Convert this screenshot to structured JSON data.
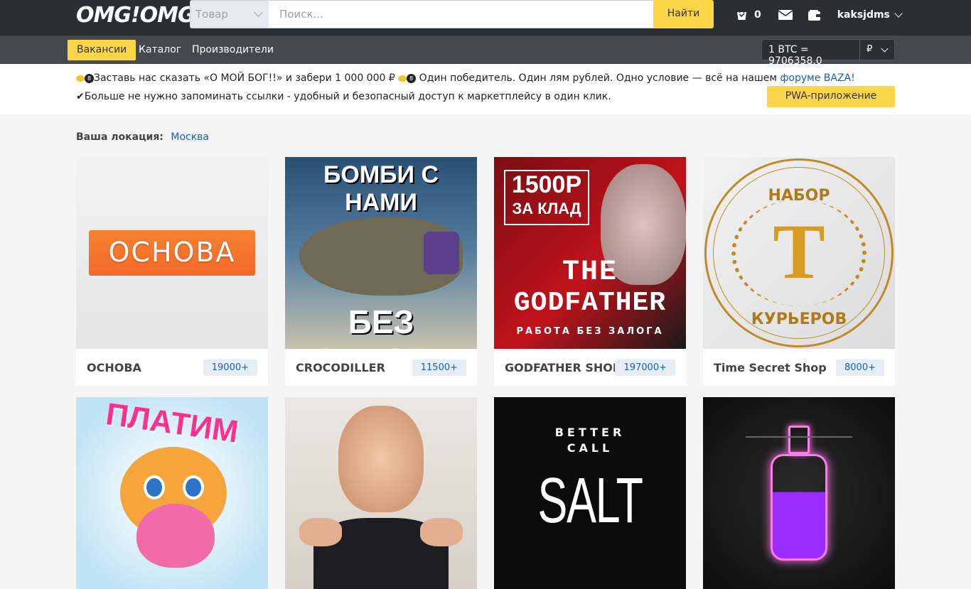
{
  "header": {
    "logo": "OMG!OMG!",
    "search_category": "Товар",
    "search_placeholder": "Поиск...",
    "search_button": "Найти",
    "cart_count": "0",
    "username": "kaksjdms"
  },
  "nav": {
    "items": [
      {
        "label": "Вакансии",
        "active": true
      },
      {
        "label": "Каталог",
        "active": false
      },
      {
        "label": "Производители",
        "active": false
      }
    ],
    "btc_rate": "1 BTC = 9706358.0",
    "currency": "₽"
  },
  "announcement": {
    "line1_text": "Заставь нас сказать «О МОЙ БОГ!!» и забери 1 000 000 ₽",
    "line1_text2": "Один победитель. Один лям рублей. Одно условие — всё на нашем",
    "line1_link": "форуме BAZA!",
    "line2_check": "✔",
    "line2_text": "Больше не нужно запоминать ссылки - удобный и безопасный доступ к маркетплейсу в один клик.",
    "pwa_button": "PWA-приложение"
  },
  "location": {
    "label": "Ваша локация:",
    "value": "Москва"
  },
  "cards": [
    {
      "name": "ОСНОВА",
      "badge": "19000+",
      "image_text": "ОСНОВА"
    },
    {
      "name": "CROCODILLER",
      "badge": "11500+",
      "image_text_top": "БОМБИ С НАМИ",
      "image_text_bottom": "БЕЗ ЗАЛОГА"
    },
    {
      "name": "GODFATHER SHOP",
      "badge": "197000+",
      "image_text_top": "1500Р",
      "image_text_top2": "ЗА КЛАД",
      "image_text_mid": "THE",
      "image_text_mid2": "GODFATHER",
      "image_text_bottom": "РАБОТА БЕЗ ЗАЛОГА"
    },
    {
      "name": "Time Secret Shop",
      "badge": "8000+",
      "image_text_top": "НАБОР",
      "image_text_letter": "Т",
      "image_text_bottom": "КУРЬЕРОВ"
    },
    {
      "name": "",
      "badge": "",
      "image_text_top": "ПЛАТИМ"
    },
    {
      "name": "",
      "badge": ""
    },
    {
      "name": "",
      "badge": "",
      "image_text_top": "BETTER",
      "image_text_mid": "CALL",
      "image_text_bottom": "SALT"
    },
    {
      "name": "",
      "badge": ""
    }
  ],
  "colors": {
    "accent": "#fdd548",
    "topbar": "#2b2f33",
    "navbar": "#45494e",
    "link": "#1a5fb4"
  }
}
